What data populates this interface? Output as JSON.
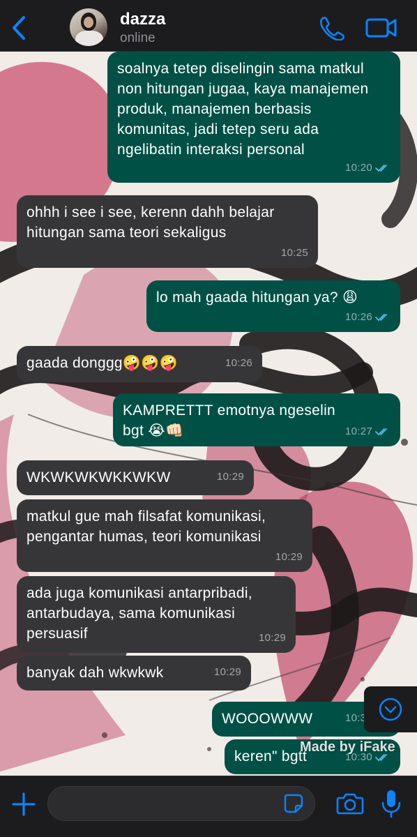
{
  "header": {
    "contact_name": "dazza",
    "status": "online"
  },
  "icons": {
    "back": "chevron-left-icon",
    "call": "phone-icon",
    "video": "video-camera-icon",
    "plus": "plus-icon",
    "sticker": "sticker-icon",
    "camera": "camera-icon",
    "mic": "microphone-icon",
    "scroll": "chevron-down-circle-icon"
  },
  "colors": {
    "accent": "#0a84ff",
    "outgoing_bubble": "#005046",
    "incoming_bubble": "#363638",
    "read_ticks": "#53bdeb"
  },
  "messages": [
    {
      "dir": "out",
      "text": "soalnya tetep diselingin sama matkul non hitungan jugaa, kaya manajemen produk, manajemen berbasis komunitas, jadi tetep seru ada ngelibatin interaksi personal",
      "time": "10:20",
      "read": true
    },
    {
      "dir": "in",
      "text": "ohhh i see i see, kerenn dahh belajar hitungan sama teori sekaligus",
      "time": "10:25"
    },
    {
      "dir": "out",
      "text": "lo mah gaada hitungan ya? 😩",
      "time": "10:26",
      "read": true
    },
    {
      "dir": "in",
      "text": "gaada donggg🤪🤪🤪",
      "time": "10:26"
    },
    {
      "dir": "out",
      "text": "KAMPRETTT emotnya ngeselin bgt 😭👊🏻",
      "time": "10:27",
      "read": true
    },
    {
      "dir": "in",
      "text": "WKWKWKWKKWKW",
      "time": "10:29"
    },
    {
      "dir": "in",
      "text": "matkul gue mah filsafat komunikasi, pengantar humas, teori komunikasi",
      "time": "10:29"
    },
    {
      "dir": "in",
      "text": "ada juga komunikasi antarpribadi, antarbudaya, sama komunikasi persuasif",
      "time": "10:29"
    },
    {
      "dir": "in",
      "text": "banyak dah wkwkwk",
      "time": "10:29"
    },
    {
      "dir": "out",
      "text": "WOOOWWW",
      "time": "10:30",
      "read": true
    },
    {
      "dir": "out",
      "text": "keren\" bgtt",
      "time": "10:30",
      "read": true
    }
  ],
  "watermark": "Made by iFake",
  "composer": {
    "value": "",
    "placeholder": ""
  }
}
